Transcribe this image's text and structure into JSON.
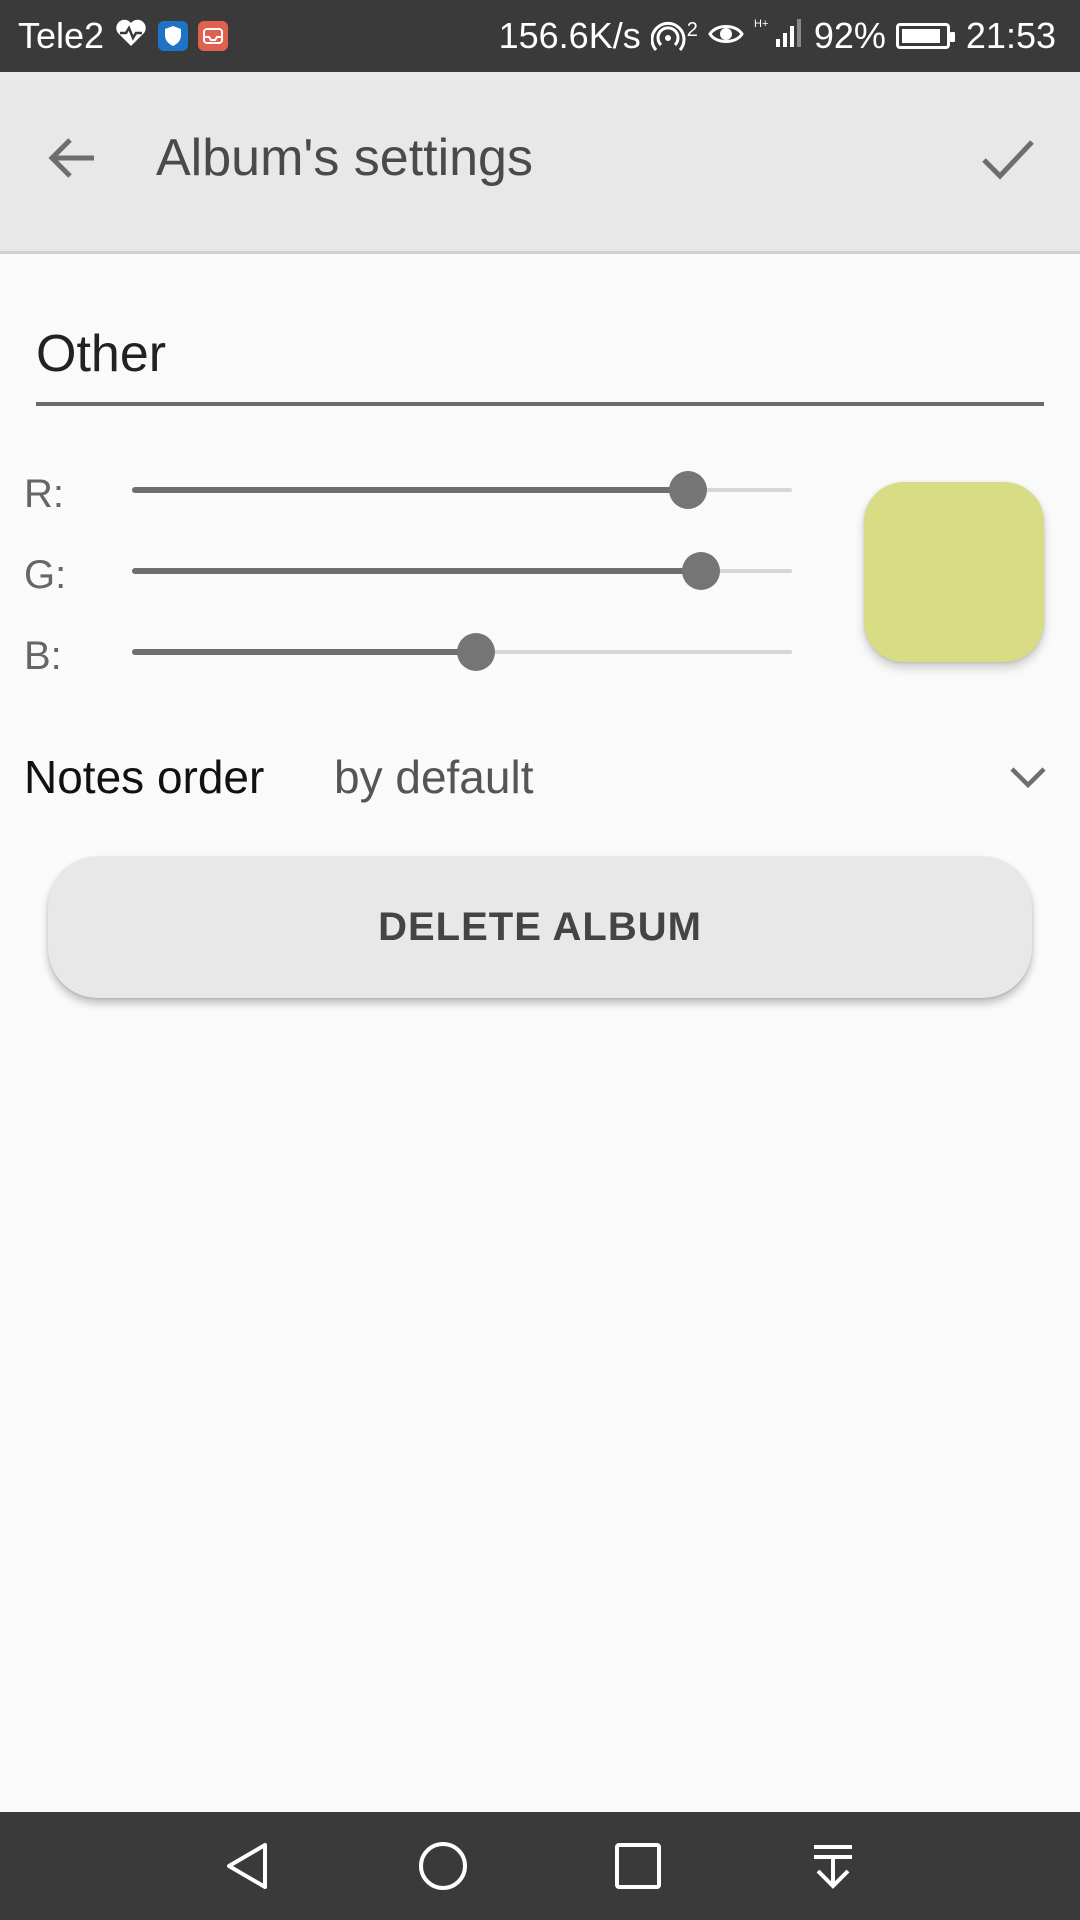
{
  "status_bar": {
    "carrier": "Tele2",
    "network_speed": "156.6K/s",
    "hotspot_count": "2",
    "battery": "92%",
    "battery_level": 0.92,
    "time": "21:53",
    "icons": [
      "heart-pulse-icon",
      "shield-app-icon",
      "inbox-app-icon",
      "hotspot-icon",
      "eye-icon",
      "signal-icon",
      "battery-icon"
    ]
  },
  "app_bar": {
    "title": "Album's settings",
    "back_icon": "arrow-back-icon",
    "confirm_icon": "check-icon"
  },
  "album": {
    "name": "Other"
  },
  "color": {
    "r_label": "R:",
    "g_label": "G:",
    "b_label": "B:",
    "r": 215,
    "g": 220,
    "b": 133,
    "max": 255,
    "preview_hex": "#d7dc85"
  },
  "notes_order": {
    "label": "Notes order",
    "value": "by default"
  },
  "delete_button": {
    "label": "DELETE ALBUM"
  },
  "nav_bar": {
    "icons": [
      "nav-back-icon",
      "nav-home-icon",
      "nav-recents-icon",
      "nav-notification-icon"
    ]
  }
}
